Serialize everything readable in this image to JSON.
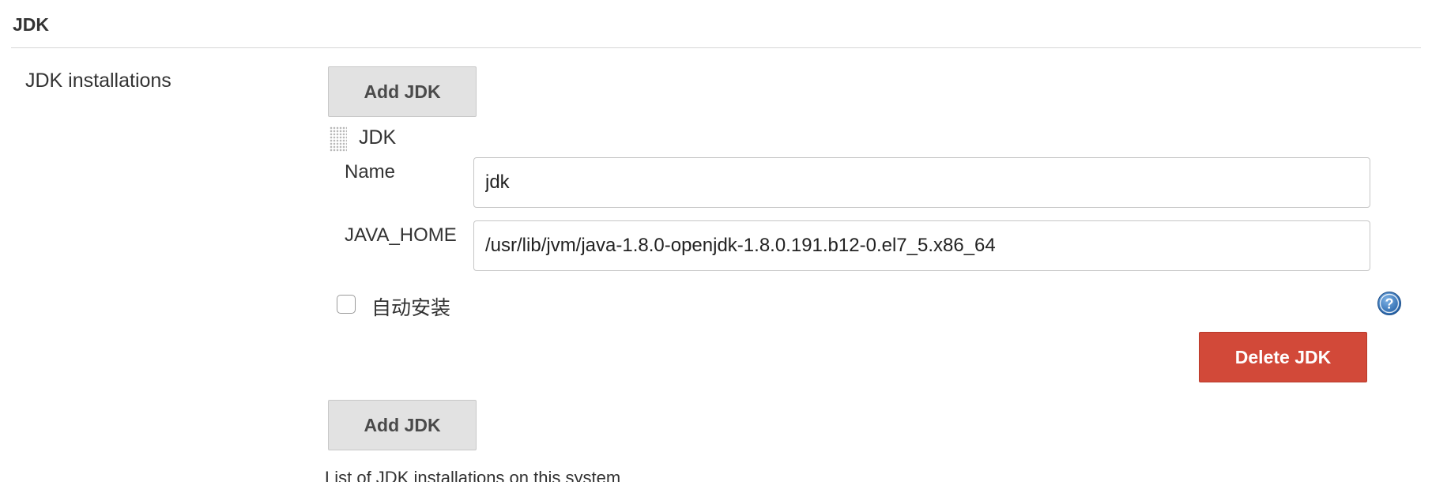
{
  "section": {
    "title": "JDK"
  },
  "jdk_installations": {
    "label": "JDK installations",
    "add_button_top": "Add JDK",
    "add_button_bottom": "Add JDK",
    "description": "List of JDK installations on this system",
    "entry": {
      "title": "JDK",
      "name_label": "Name",
      "name_value": "jdk",
      "java_home_label": "JAVA_HOME",
      "java_home_value": "/usr/lib/jvm/java-1.8.0-openjdk-1.8.0.191.b12-0.el7_5.x86_64",
      "auto_install_label": "自动安装",
      "auto_install_checked": false,
      "delete_button": "Delete JDK",
      "help_icon": "help-icon"
    }
  },
  "colors": {
    "delete_button": "#d24939",
    "gray_button": "#e2e2e2",
    "help_icon": "#2e76b8"
  }
}
